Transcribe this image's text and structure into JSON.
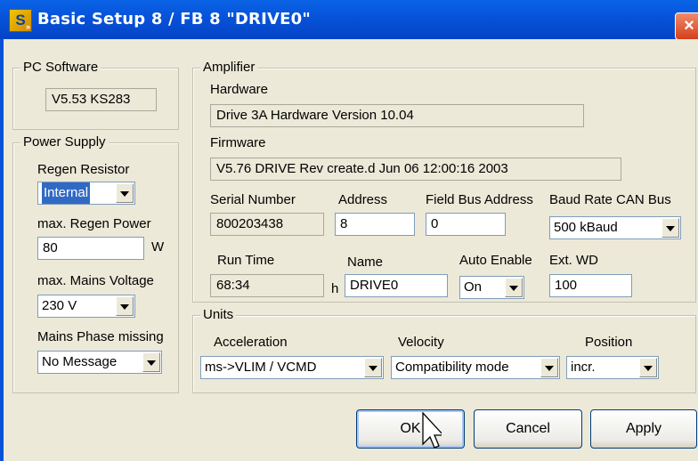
{
  "window": {
    "title": "Basic Setup 8 / FB 8 \"DRIVE0\"",
    "icon": "S",
    "close": "×"
  },
  "pc_software": {
    "group": "PC Software",
    "version": "V5.53 KS283"
  },
  "power_supply": {
    "group": "Power Supply",
    "regen_resistor_label": "Regen Resistor",
    "regen_resistor_value": "Internal",
    "max_regen_power_label": "max. Regen Power",
    "max_regen_power_value": "80",
    "max_regen_power_unit": "W",
    "max_mains_voltage_label": "max. Mains Voltage",
    "max_mains_voltage_value": "230 V",
    "mains_phase_missing_label": "Mains Phase missing",
    "mains_phase_missing_value": "No Message"
  },
  "amplifier": {
    "group": "Amplifier",
    "hardware_label": "Hardware",
    "hardware_value": "Drive 3A Hardware Version 10.04",
    "firmware_label": "Firmware",
    "firmware_value": "V5.76 DRIVE Rev create.d Jun 06 12:00:16 2003",
    "serial_label": "Serial Number",
    "serial_value": "800203438",
    "address_label": "Address",
    "address_value": "8",
    "fieldbus_label": "Field Bus Address",
    "fieldbus_value": "0",
    "baud_label": "Baud Rate CAN Bus",
    "baud_value": "500 kBaud",
    "runtime_label": "Run Time",
    "runtime_value": "68:34",
    "runtime_unit": "h",
    "name_label": "Name",
    "name_value": "DRIVE0",
    "auto_enable_label": "Auto Enable",
    "auto_enable_value": "On",
    "ext_wd_label": "Ext. WD",
    "ext_wd_value": "100"
  },
  "units": {
    "group": "Units",
    "acceleration_label": "Acceleration",
    "acceleration_value": "ms->VLIM / VCMD",
    "velocity_label": "Velocity",
    "velocity_value": "Compatibility mode",
    "position_label": "Position",
    "position_value": "incr."
  },
  "buttons": {
    "ok": "OK",
    "cancel": "Cancel",
    "apply": "Apply"
  }
}
